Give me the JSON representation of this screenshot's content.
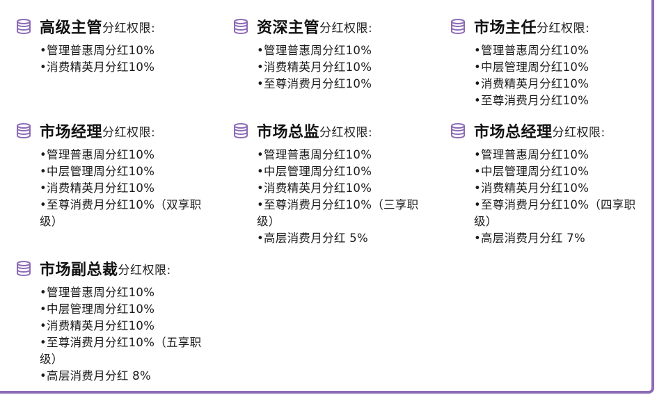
{
  "colors": {
    "accent": "#8d6bb6",
    "text": "#1a1a1a"
  },
  "icon": "database-icon",
  "cards": [
    {
      "title": "高级主管",
      "suffix": "分红权限:",
      "items": [
        "•管理普惠周分红10%",
        "•消费精英月分红10%"
      ]
    },
    {
      "title": "资深主管",
      "suffix": "分红权限:",
      "items": [
        "•管理普惠周分红10%",
        "•消费精英月分红10%",
        "•至尊消费月分红10%"
      ]
    },
    {
      "title": "市场主任",
      "suffix": "分红权限:",
      "items": [
        "•管理普惠周分红10%",
        "•中层管理周分红10%",
        "•消费精英月分红10%",
        "•至尊消费月分红10%"
      ]
    },
    {
      "title": "市场经理",
      "suffix": "分红权限:",
      "items": [
        "•管理普惠周分红10%",
        "•中层管理周分红10%",
        "•消费精英月分红10%",
        "•至尊消费月分红10%（双享职级）"
      ]
    },
    {
      "title": "市场总监",
      "suffix": "分红权限:",
      "items": [
        "•管理普惠周分红10%",
        "•中层管理周分红10%",
        "•消费精英月分红10%",
        "•至尊消费月分红10%（三享职级）",
        "•高层消费月分红 5%"
      ]
    },
    {
      "title": "市场总经理",
      "suffix": "分红权限:",
      "items": [
        "•管理普惠周分红10%",
        "•中层管理周分红10%",
        "•消费精英月分红10%",
        "•至尊消费月分红10%（四享职级）",
        "•高层消费月分红 7%"
      ]
    },
    {
      "title": "市场副总裁",
      "suffix": "分红权限:",
      "items": [
        "•管理普惠周分红10%",
        "•中层管理周分红10%",
        "•消费精英月分红10%",
        "•至尊消费月分红10%（五享职级）",
        "•高层消费月分红 8%"
      ]
    }
  ]
}
